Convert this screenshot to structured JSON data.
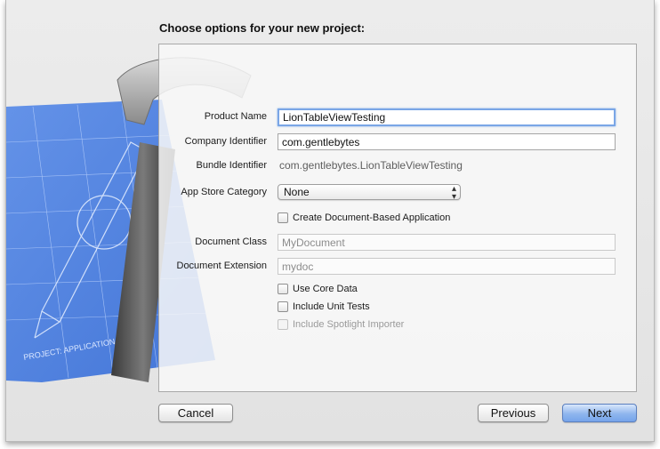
{
  "dialog": {
    "title": "Choose options for your new project:"
  },
  "form": {
    "product_name": {
      "label": "Product Name",
      "value": "LionTableViewTesting"
    },
    "company_identifier": {
      "label": "Company Identifier",
      "value": "com.gentlebytes"
    },
    "bundle_identifier": {
      "label": "Bundle Identifier",
      "value": "com.gentlebytes.LionTableViewTesting"
    },
    "app_store_category": {
      "label": "App Store Category",
      "value": "None"
    },
    "create_document_based": {
      "label": "Create Document-Based Application",
      "checked": false
    },
    "document_class": {
      "label": "Document Class",
      "value": "MyDocument"
    },
    "document_extension": {
      "label": "Document Extension",
      "value": "mydoc"
    },
    "use_core_data": {
      "label": "Use Core Data",
      "checked": false
    },
    "include_unit_tests": {
      "label": "Include Unit Tests",
      "checked": false
    },
    "include_spotlight_importer": {
      "label": "Include Spotlight Importer",
      "checked": false,
      "enabled": false
    }
  },
  "buttons": {
    "cancel": "Cancel",
    "previous": "Previous",
    "next": "Next"
  },
  "background_art": {
    "icon": "xcode-blueprint-hammer-icon",
    "blueprint_text": "PROJECT: APPLICATION.APP"
  }
}
